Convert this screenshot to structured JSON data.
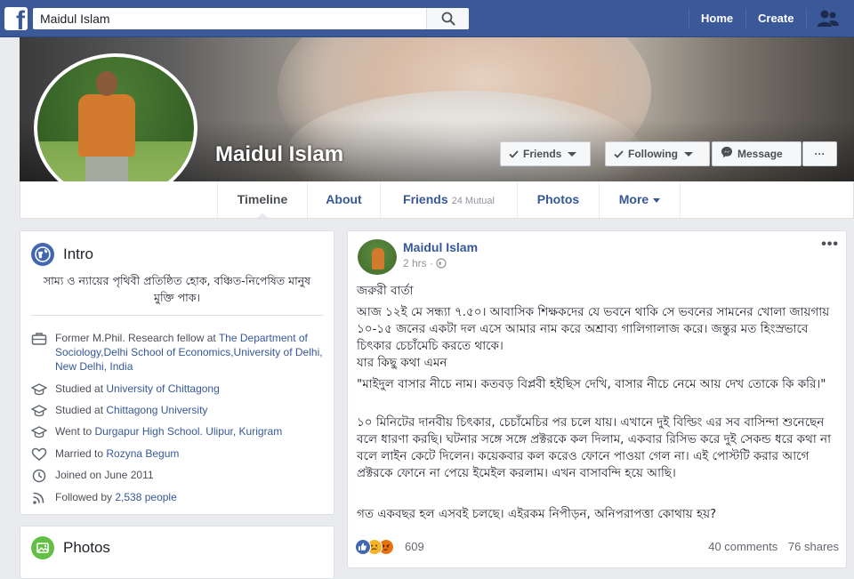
{
  "topbar": {
    "logo": "f",
    "search_value": "Maidul Islam",
    "nav": {
      "home": "Home",
      "create": "Create"
    },
    "icons": [
      "search-icon",
      "friend-requests-icon"
    ]
  },
  "profile": {
    "name": "Maidul Islam",
    "buttons": {
      "friends": "Friends",
      "following": "Following",
      "message": "Message",
      "more": "···"
    }
  },
  "tabs": {
    "timeline": "Timeline",
    "about": "About",
    "friends": "Friends",
    "friends_mutual": "24 Mutual",
    "photos": "Photos",
    "more": "More"
  },
  "intro": {
    "title": "Intro",
    "bio": "সাম্য ও ন্যায়ের পৃথিবী প্রতিষ্ঠিত হোক, বঞ্চিত-নিপেষিত মানুষ মুক্তি পাক।",
    "work": {
      "prefix": "Former M.Phil. Research fellow at ",
      "place": "The Department of Sociology,Delhi School of Economics,University of Delhi, New Delhi, India"
    },
    "edu1": {
      "prefix": "Studied at ",
      "place": "University of Chittagong"
    },
    "edu2": {
      "prefix": "Studied at ",
      "place": "Chittagong University"
    },
    "school": {
      "prefix": "Went to ",
      "place": "Durgapur High School. Ulipur, Kurigram"
    },
    "relationship": {
      "prefix": "Married to ",
      "person": "Rozyna Begum"
    },
    "joined": "Joined on June 2011",
    "followers": {
      "prefix": "Followed by ",
      "count": "2,538 people"
    }
  },
  "photos_card": {
    "title": "Photos"
  },
  "post": {
    "author": "Maidul Islam",
    "time": "2 hrs · ",
    "more": "•••",
    "paragraphs": [
      "জরুরী বার্তা",
      "আজ ১২ই মে সন্ধ্যা ৭.৫০। আবাসিক শিক্ষকদের যে ভবনে থাকি সে ভবনের সামনের খোলা জায়গায় ১০-১৫ জনের একটা দল এসে আমার নাম করে অশ্রাব্য গালিগালাজ করে। জন্তুর মত হিংস্রভাবে চিৎকার চেচাঁমেচি করতে থাকে।",
      "যার কিছু কথা এমন",
      "\"মাইদুল বাসার নীচে নাম। কতবড় বিপ্লবী হইছিস দেখি, বাসার নীচে নেমে আয় দেখ তোকে কি করি।\"",
      "১০ মিনিটের দানবীয় চিৎকার, চেচাঁমেচির পর চলে যায়। এখানে দুই বিল্ডিং এর সব বাসিন্দা শুনেছেন বলে ধারণা করছি। ঘটনার সঙ্গে সঙ্গে প্রক্টরকে কল দিলাম, একবার রিসিভ করে দুই সেকন্ড ধরে কথা না বলে লাইন কেটে দিলেন। কয়েকবার কল করেও ফোনে পাওয়া গেল না। এই পোস্টটি করার আগে প্রক্টরকে ফোনে না পেয়ে ইমেইল করলাম। এখন বাসাবন্দি হয়ে আছি।",
      "গত একবছর হল এসবই চলছে। এইরকম নিপীড়ন, অনিপরাপত্তা কোথায় হয়?"
    ],
    "reactions": {
      "count": "609",
      "types": [
        "like",
        "sad",
        "angry"
      ]
    },
    "comments": "40 comments",
    "shares": "76 shares"
  },
  "colors": {
    "brand": "#3b5998",
    "link": "#365899",
    "background": "#e9ebee",
    "intro_icon": "#4267b2",
    "photos_icon": "#63be45"
  }
}
